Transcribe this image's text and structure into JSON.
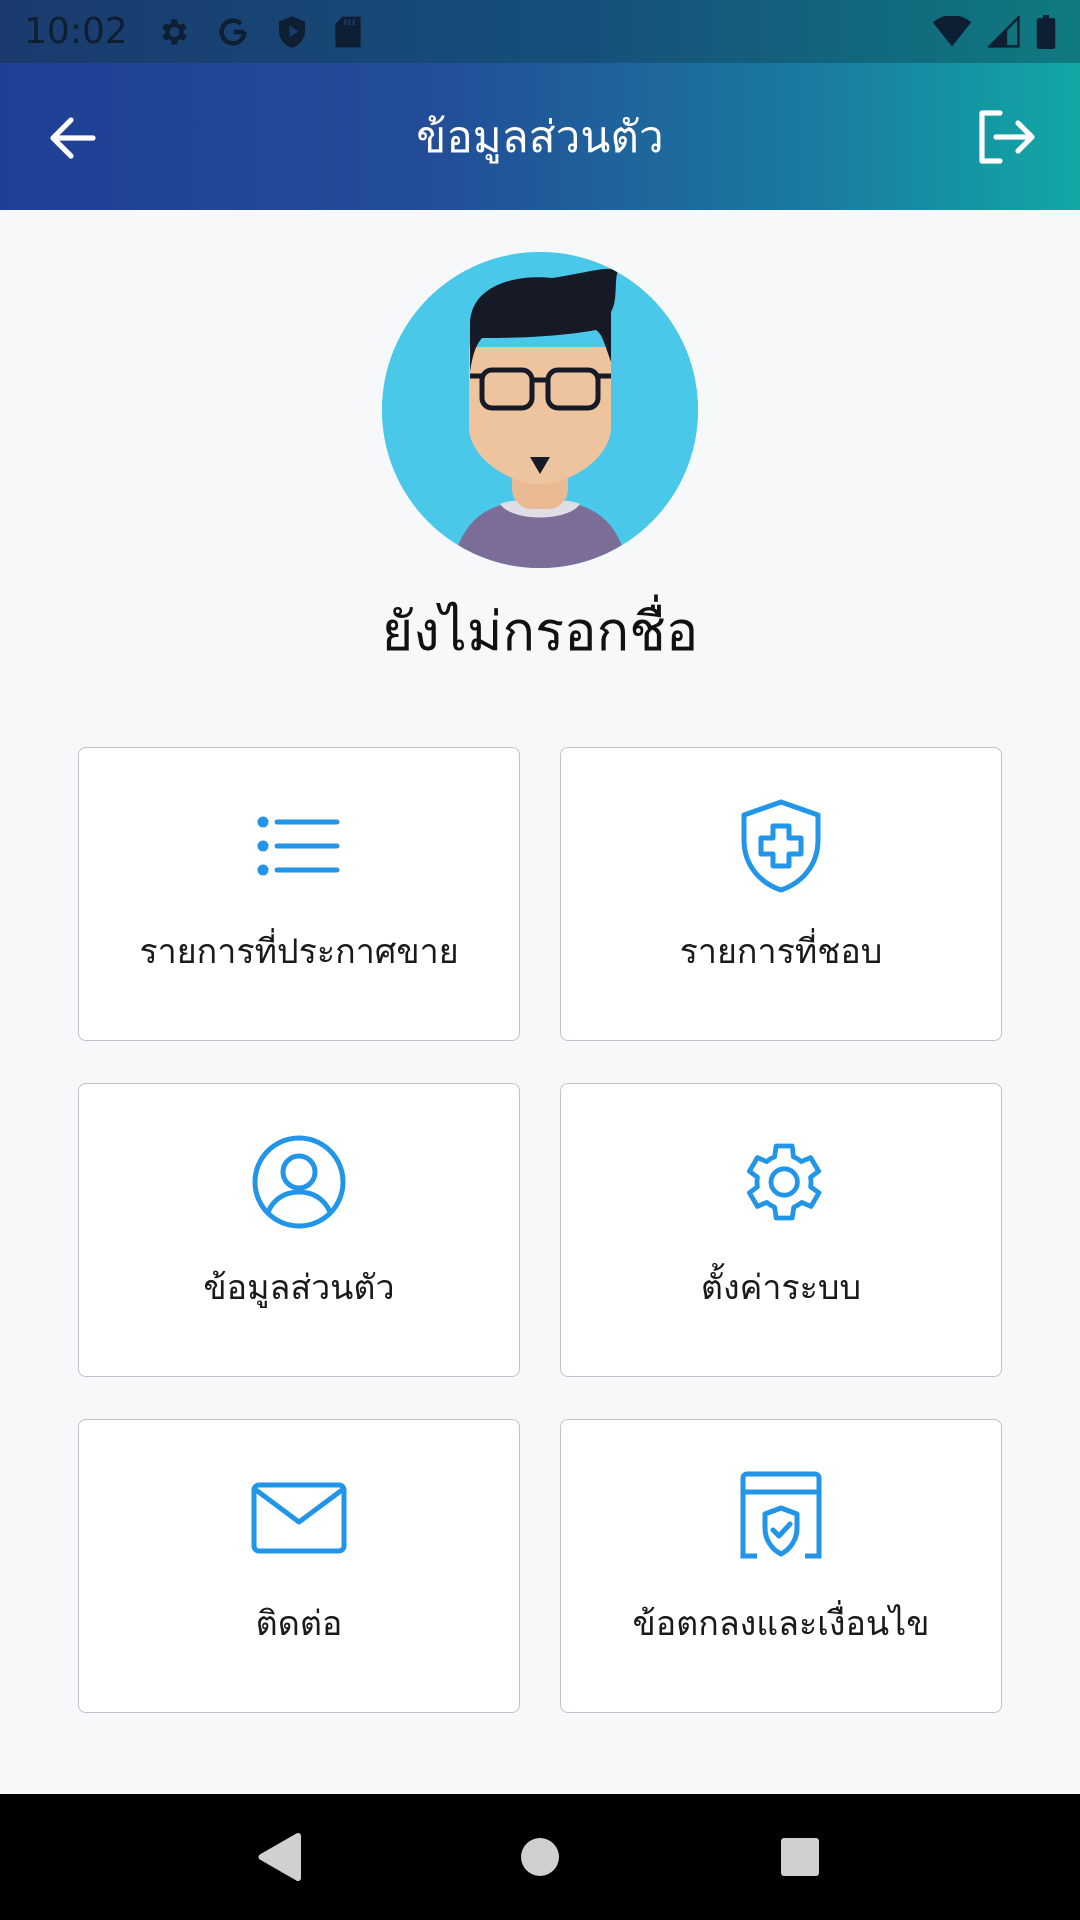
{
  "status_bar": {
    "time": "10:02",
    "left_icons": [
      "gear-icon",
      "google-icon",
      "shield-play-icon",
      "sd-card-icon"
    ],
    "right_icons": [
      "wifi-icon",
      "signal-icon",
      "battery-icon"
    ]
  },
  "app_bar": {
    "title": "ข้อมูลส่วนตัว",
    "back_icon": "arrow-left-icon",
    "logout_icon": "logout-icon",
    "gradient": [
      "#1f3f95",
      "#12a8a5"
    ]
  },
  "profile": {
    "name": "ยังไม่กรอกชื่อ",
    "avatar_bg": "#4ac8ea"
  },
  "menu": {
    "accent": "#2196e8",
    "items": [
      {
        "label": "รายการที่ประกาศขาย",
        "icon": "list-icon"
      },
      {
        "label": "รายการที่ชอบ",
        "icon": "shield-plus-icon"
      },
      {
        "label": "ข้อมูลส่วนตัว",
        "icon": "user-circle-icon"
      },
      {
        "label": "ตั้งค่าระบบ",
        "icon": "gear-icon"
      },
      {
        "label": "ติดต่อ",
        "icon": "mail-icon"
      },
      {
        "label": "ข้อตกลงและเงื่อนไข",
        "icon": "terms-shield-icon"
      }
    ]
  },
  "nav_bar": {
    "buttons": [
      "back-triangle-icon",
      "home-circle-icon",
      "recents-square-icon"
    ]
  }
}
